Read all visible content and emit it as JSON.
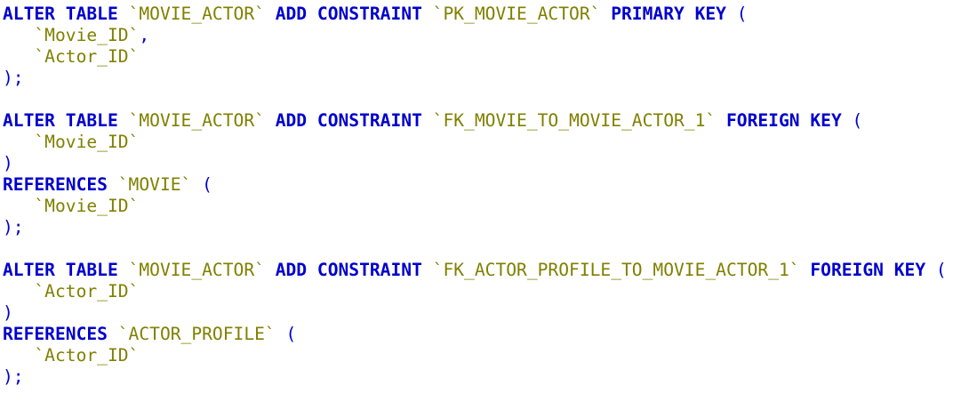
{
  "editor": {
    "colors": {
      "keyword": "#0000cc",
      "identifier": "#808000",
      "punctuation": "#0000cc",
      "background": "#ffffff"
    },
    "lines": [
      [
        {
          "t": "ALTER TABLE",
          "c": "kw"
        },
        {
          "t": " ",
          "c": "ws"
        },
        {
          "t": "`MOVIE_ACTOR`",
          "c": "str"
        },
        {
          "t": " ",
          "c": "ws"
        },
        {
          "t": "ADD CONSTRAINT",
          "c": "kw"
        },
        {
          "t": " ",
          "c": "ws"
        },
        {
          "t": "`PK_MOVIE_ACTOR`",
          "c": "str"
        },
        {
          "t": " ",
          "c": "ws"
        },
        {
          "t": "PRIMARY KEY",
          "c": "kw"
        },
        {
          "t": " ",
          "c": "ws"
        },
        {
          "t": "(",
          "c": "punc"
        }
      ],
      [
        {
          "t": "   ",
          "c": "ws"
        },
        {
          "t": "`Movie_ID`",
          "c": "str"
        },
        {
          "t": ",",
          "c": "punc"
        }
      ],
      [
        {
          "t": "   ",
          "c": "ws"
        },
        {
          "t": "`Actor_ID`",
          "c": "str"
        }
      ],
      [
        {
          "t": ");",
          "c": "punc"
        }
      ],
      [],
      [
        {
          "t": "ALTER TABLE",
          "c": "kw"
        },
        {
          "t": " ",
          "c": "ws"
        },
        {
          "t": "`MOVIE_ACTOR`",
          "c": "str"
        },
        {
          "t": " ",
          "c": "ws"
        },
        {
          "t": "ADD CONSTRAINT",
          "c": "kw"
        },
        {
          "t": " ",
          "c": "ws"
        },
        {
          "t": "`FK_MOVIE_TO_MOVIE_ACTOR_1`",
          "c": "str"
        },
        {
          "t": " ",
          "c": "ws"
        },
        {
          "t": "FOREIGN KEY",
          "c": "kw"
        },
        {
          "t": " ",
          "c": "ws"
        },
        {
          "t": "(",
          "c": "punc"
        }
      ],
      [
        {
          "t": "   ",
          "c": "ws"
        },
        {
          "t": "`Movie_ID`",
          "c": "str"
        }
      ],
      [
        {
          "t": ")",
          "c": "punc"
        }
      ],
      [
        {
          "t": "REFERENCES",
          "c": "kw"
        },
        {
          "t": " ",
          "c": "ws"
        },
        {
          "t": "`MOVIE`",
          "c": "str"
        },
        {
          "t": " ",
          "c": "ws"
        },
        {
          "t": "(",
          "c": "punc"
        }
      ],
      [
        {
          "t": "   ",
          "c": "ws"
        },
        {
          "t": "`Movie_ID`",
          "c": "str"
        }
      ],
      [
        {
          "t": ");",
          "c": "punc"
        }
      ],
      [],
      [
        {
          "t": "ALTER TABLE",
          "c": "kw"
        },
        {
          "t": " ",
          "c": "ws"
        },
        {
          "t": "`MOVIE_ACTOR`",
          "c": "str"
        },
        {
          "t": " ",
          "c": "ws"
        },
        {
          "t": "ADD CONSTRAINT",
          "c": "kw"
        },
        {
          "t": " ",
          "c": "ws"
        },
        {
          "t": "`FK_ACTOR_PROFILE_TO_MOVIE_ACTOR_1`",
          "c": "str"
        },
        {
          "t": " ",
          "c": "ws"
        },
        {
          "t": "FOREIGN KEY",
          "c": "kw"
        },
        {
          "t": " ",
          "c": "ws"
        },
        {
          "t": "(",
          "c": "punc"
        }
      ],
      [
        {
          "t": "   ",
          "c": "ws"
        },
        {
          "t": "`Actor_ID`",
          "c": "str"
        }
      ],
      [
        {
          "t": ")",
          "c": "punc"
        }
      ],
      [
        {
          "t": "REFERENCES",
          "c": "kw"
        },
        {
          "t": " ",
          "c": "ws"
        },
        {
          "t": "`ACTOR_PROFILE`",
          "c": "str"
        },
        {
          "t": " ",
          "c": "ws"
        },
        {
          "t": "(",
          "c": "punc"
        }
      ],
      [
        {
          "t": "   ",
          "c": "ws"
        },
        {
          "t": "`Actor_ID`",
          "c": "str"
        }
      ],
      [
        {
          "t": ");",
          "c": "punc"
        }
      ]
    ]
  }
}
